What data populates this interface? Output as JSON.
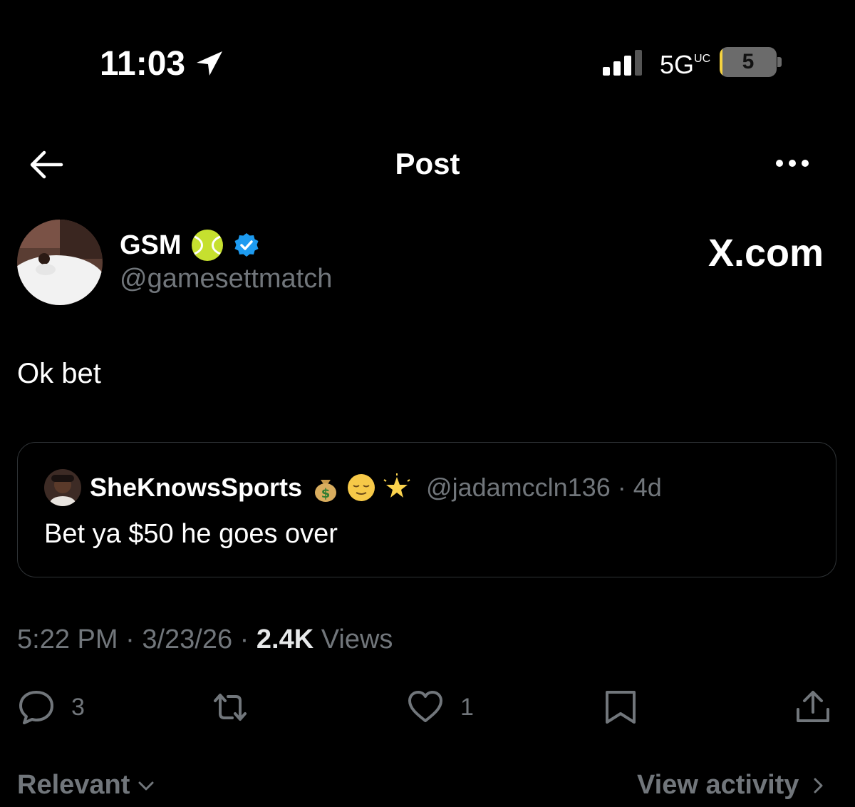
{
  "status_bar": {
    "time": "11:03",
    "network": "5G",
    "network_suffix": "UC",
    "battery_level": "5",
    "battery_fraction": 0.05
  },
  "nav": {
    "title": "Post"
  },
  "author": {
    "name": "GSM",
    "handle": "@gamesettmatch",
    "icons": [
      "tennis-ball-emoji",
      "verified-badge"
    ]
  },
  "brand": "X.com",
  "tweet": {
    "text": "Ok bet"
  },
  "quoted": {
    "name": "SheKnowsSports",
    "emojis": [
      "money-bag",
      "relieved-face",
      "glowing-star"
    ],
    "handle": "@jadamccln136",
    "age": "4d",
    "text": "Bet ya $50 he goes over"
  },
  "meta": {
    "time": "5:22 PM",
    "date": "3/23/26",
    "views_count": "2.4K",
    "views_label": "Views"
  },
  "actions": {
    "replies": "3",
    "likes": "1"
  },
  "footer": {
    "sort_label": "Relevant",
    "activity_label": "View activity"
  },
  "colors": {
    "background": "#000000",
    "primary_text": "#ffffff",
    "secondary_text": "#71767b",
    "border": "#2f3336",
    "verified": "#1d9bf0",
    "battery_fill": "#f5d340"
  }
}
